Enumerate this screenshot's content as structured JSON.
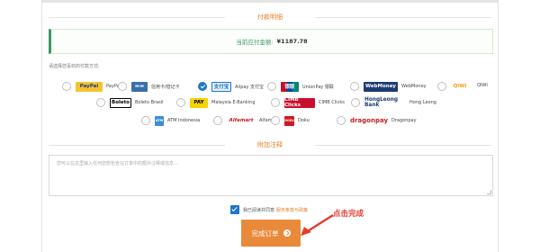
{
  "payment_detail": {
    "title": "付款明细",
    "total_label": "当前应付金额:",
    "total_amount": "¥1187.78"
  },
  "payment_method": {
    "hint": "请选择您喜欢的付款方式:",
    "selected": "Alipay 支付宝",
    "options": [
      {
        "label": "PayPal",
        "logo_text": "PayPal",
        "logo_color": "#1a3a8c"
      },
      {
        "label": "信用卡/借记卡",
        "logo_text": "▬▬",
        "logo_color": "#3b6ea8"
      },
      {
        "label": "Alipay 支付宝",
        "logo_text": "支付宝",
        "logo_color": "#1a73c9"
      },
      {
        "label": "UnionPay 银联",
        "logo_text": "银联",
        "logo_color": "#c8102e"
      },
      {
        "label": "WebMoney",
        "logo_text": "WebMoney",
        "logo_color": "#ffffff"
      },
      {
        "label": "QIWI",
        "logo_text": "QIWI",
        "logo_color": "#f39c12"
      },
      {
        "label": "Boleto Brasil",
        "logo_text": "Boleto",
        "logo_color": "#000000"
      },
      {
        "label": "Malaysia E-Banking",
        "logo_text": "PAY",
        "logo_color": "#000000"
      },
      {
        "label": "CIMB Clicks",
        "logo_text": "CIMB Clicks",
        "logo_color": "#ffffff"
      },
      {
        "label": "Hong Leong",
        "logo_text": "HongLeong Bank",
        "logo_color": "#1d3b73"
      },
      {
        "label": "ATM Indonesia",
        "logo_text": "ATM",
        "logo_color": "#3a8fd6"
      },
      {
        "label": "Alfamart",
        "logo_text": "Alfamart",
        "logo_color": "#d2161e"
      },
      {
        "label": "Doku",
        "logo_text": "DOKU",
        "logo_color": "#ffffff"
      },
      {
        "label": "Dragonpay",
        "logo_text": "dragonpay",
        "logo_color": "#c81e1e"
      }
    ]
  },
  "notes": {
    "title": "附加注释",
    "placeholder": "您可以在这里输入任何您想包含在订单中的额外注释或信息..."
  },
  "agreement": {
    "checked": true,
    "text": "我已阅读并同意",
    "link": "服务条款与政策"
  },
  "submit": {
    "label": "完成订单"
  },
  "callout": {
    "text": "点击完成",
    "color": "#e33b2e"
  },
  "colors": {
    "accent": "#e98a3a",
    "success": "#3c9a5f",
    "selected": "#1f77c9"
  }
}
